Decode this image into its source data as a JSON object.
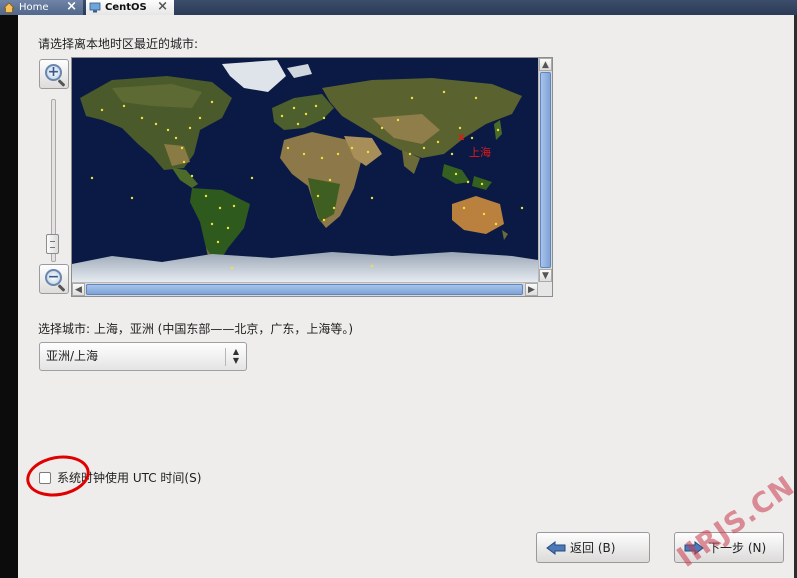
{
  "tabs": [
    {
      "label": "Home"
    },
    {
      "label": "CentOS"
    }
  ],
  "prompt": "请选择离本地时区最近的城市:",
  "map": {
    "marker_label": "上海"
  },
  "selected_city_text": "选择城市: 上海，亚洲 (中国东部——北京，广东，上海等。)",
  "timezone_combo": {
    "value": "亚洲/上海"
  },
  "utc_checkbox": {
    "label": "系统时钟使用 UTC 时间(S)",
    "checked": false
  },
  "buttons": {
    "back": "返回 (B)",
    "next": "下一步 (N)"
  },
  "watermark": "IIRJS.CN",
  "colors": {
    "accent_red": "#e00000",
    "map_ocean": "#0b1a44",
    "scroll_blue": "#7fa3d8"
  }
}
